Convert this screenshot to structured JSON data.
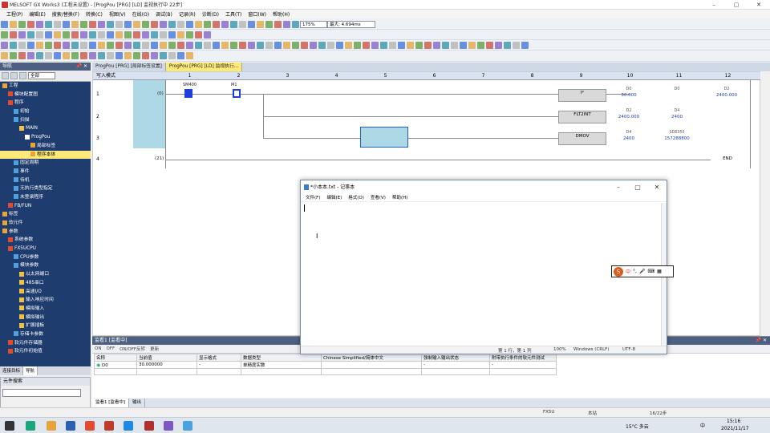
{
  "window": {
    "title": "MELSOFT GX Works3 (工程未设置) - [ProgPou [PRG] [LD] 监视执行中 22步]"
  },
  "menu": [
    "工程(P)",
    "编辑(E)",
    "搜索/替换(F)",
    "转换(C)",
    "视图(V)",
    "在线(O)",
    "调试(B)",
    "记录(R)",
    "诊断(D)",
    "工具(T)",
    "窗口(W)",
    "帮助(H)"
  ],
  "toolbar": {
    "zoom": "175%",
    "max_scan": "最大: 4.694ms"
  },
  "nav": {
    "title": "导航",
    "filter": "全部",
    "items": [
      {
        "label": "工程",
        "indent": 0
      },
      {
        "label": "模块配置图",
        "indent": 1
      },
      {
        "label": "程序",
        "indent": 1
      },
      {
        "label": "初始",
        "indent": 2
      },
      {
        "label": "扫描",
        "indent": 2
      },
      {
        "label": "MAIN",
        "indent": 3
      },
      {
        "label": "ProgPou",
        "indent": 4
      },
      {
        "label": "局部标签",
        "indent": 5
      },
      {
        "label": "程序本体",
        "indent": 5,
        "selected": true
      },
      {
        "label": "固定周期",
        "indent": 2
      },
      {
        "label": "事件",
        "indent": 2
      },
      {
        "label": "待机",
        "indent": 2
      },
      {
        "label": "无执行类型指定",
        "indent": 2
      },
      {
        "label": "未登录程序",
        "indent": 2
      },
      {
        "label": "FB/FUN",
        "indent": 1
      },
      {
        "label": "标签",
        "indent": 0
      },
      {
        "label": "软元件",
        "indent": 0
      },
      {
        "label": "参数",
        "indent": 0
      },
      {
        "label": "系统参数",
        "indent": 1
      },
      {
        "label": "FX5UCPU",
        "indent": 1
      },
      {
        "label": "CPU参数",
        "indent": 2
      },
      {
        "label": "模块参数",
        "indent": 2
      },
      {
        "label": "以太网端口",
        "indent": 3
      },
      {
        "label": "485串口",
        "indent": 3
      },
      {
        "label": "高速I/O",
        "indent": 3
      },
      {
        "label": "输入响应时间",
        "indent": 3
      },
      {
        "label": "模拟输入",
        "indent": 3
      },
      {
        "label": "模拟输出",
        "indent": 3
      },
      {
        "label": "扩展插板",
        "indent": 3
      },
      {
        "label": "存储卡参数",
        "indent": 2
      },
      {
        "label": "软元件存储器",
        "indent": 1
      },
      {
        "label": "软元件初始值",
        "indent": 1
      }
    ],
    "tabs": [
      "连接目标",
      "导航"
    ],
    "search_title": "元件搜索"
  },
  "editor_tabs": [
    "ProgPou [PRG] [局部标签设置]",
    "ProgPou [PRG] [LD] 监视执行..."
  ],
  "ladder": {
    "header_label": "写入模式",
    "columns": [
      "1",
      "2",
      "3",
      "4",
      "5",
      "6",
      "7",
      "8",
      "9",
      "10",
      "11",
      "12"
    ],
    "rows": [
      "1",
      "2",
      "3",
      "4"
    ],
    "step_numbers": [
      "(0)",
      "(21)"
    ],
    "contacts": [
      {
        "label": "SM400"
      },
      {
        "label": "M1"
      }
    ],
    "instructions": [
      {
        "name": "I*",
        "op1_label": "D0",
        "op1_value": "30.000",
        "op2_label": "D0",
        "op2_value": "",
        "op3_label": "D2",
        "op3_value": "2400.000"
      },
      {
        "name": "FLT2INT",
        "op1_label": "D2",
        "op1_value": "2400.000",
        "op2_label": "D4",
        "op2_value": "2400"
      },
      {
        "name": "DMOV",
        "op1_label": "D4",
        "op1_value": "2400",
        "op2_label": "SD8350",
        "op2_value": "157288800"
      }
    ],
    "end_label": "END"
  },
  "watch": {
    "title": "监看1 [监看中]",
    "tools": [
      "ON",
      "OFF",
      "ON/OFF反转",
      "更新"
    ],
    "headers": [
      "名称",
      "当前值",
      "显示格式",
      "数据类型",
      "Chinese Simplified/简体中文",
      "强制输入输出状态",
      "附带执行条件的软元件测试"
    ],
    "row": {
      "name": "D0",
      "value": "30.000000",
      "format": "-",
      "type": "单精度实数",
      "comment": "",
      "force": "-",
      "test": "-"
    }
  },
  "bottom_tabs": [
    "监看1 [监看中]",
    "输出"
  ],
  "status": {
    "cpu": "FX5U",
    "station": "本站",
    "step": "16/22步"
  },
  "notepad": {
    "title": "*小本本.txt - 记事本",
    "menu": [
      "文件(F)",
      "编辑(E)",
      "格式(O)",
      "查看(V)",
      "帮助(H)"
    ],
    "status_pos": "第 1 行，第 1 列",
    "status_zoom": "100%",
    "status_eol": "Windows (CRLF)",
    "status_enc": "UTF-8"
  },
  "ime": {
    "mode": "中"
  },
  "taskbar": {
    "weather": "15°C 多云",
    "time": "15:16",
    "date": "2021/11/17",
    "ime": "中"
  }
}
